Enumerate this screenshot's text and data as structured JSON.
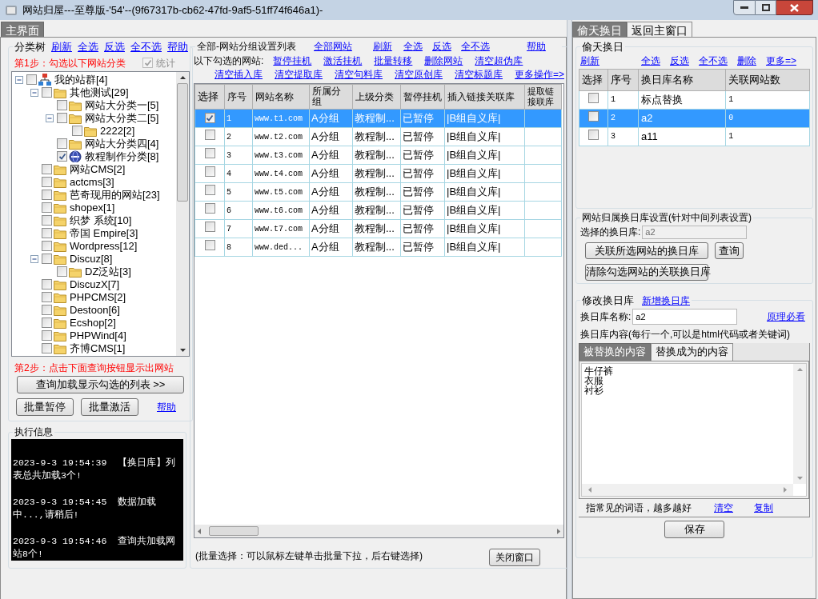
{
  "window": {
    "title": "网站归屋---至尊版-'54'--(9f67317b-cb62-47fd-9af5-51ff74f646a1)-"
  },
  "main_tabs": [
    {
      "label": "主界面",
      "selected": true
    }
  ],
  "category_tree": {
    "title": "分类树",
    "links": [
      "刷新",
      "全选",
      "反选",
      "全不选",
      "帮助"
    ],
    "step1": "第1步：勾选以下网站分类",
    "stats_checkbox": {
      "label": "统计",
      "checked": true,
      "disabled": true
    },
    "items": [
      {
        "label": "我的站群[4]",
        "kind": "network",
        "checked": false,
        "expanded": true,
        "children": [
          {
            "label": "其他测试[29]",
            "kind": "folder",
            "checked": false,
            "expanded": true,
            "children": [
              {
                "label": "网站大分类一[5]",
                "kind": "folder",
                "checked": false
              },
              {
                "label": "网站大分类二[5]",
                "kind": "folder",
                "checked": false,
                "expanded": true,
                "children": [
                  {
                    "label": "2222[2]",
                    "kind": "folder",
                    "checked": false
                  }
                ]
              },
              {
                "label": "网站大分类四[4]",
                "kind": "folder",
                "checked": false
              },
              {
                "label": "教程制作分类[8]",
                "kind": "globe",
                "checked": true
              }
            ]
          },
          {
            "label": "网站CMS[2]",
            "kind": "folder",
            "checked": false
          },
          {
            "label": "actcms[3]",
            "kind": "folder",
            "checked": false
          },
          {
            "label": "芭奇现用的网站[23]",
            "kind": "folder",
            "checked": false
          },
          {
            "label": "shopex[1]",
            "kind": "folder",
            "checked": false
          },
          {
            "label": "织梦 系统[10]",
            "kind": "folder",
            "checked": false
          },
          {
            "label": "帝国 Empire[3]",
            "kind": "folder",
            "checked": false
          },
          {
            "label": "Wordpress[12]",
            "kind": "folder",
            "checked": false
          },
          {
            "label": "Discuz[8]",
            "kind": "folder",
            "checked": false,
            "expanded": true,
            "children": [
              {
                "label": "DZ泛站[3]",
                "kind": "folder",
                "checked": false
              }
            ]
          },
          {
            "label": "DiscuzX[7]",
            "kind": "folder",
            "checked": false
          },
          {
            "label": "PHPCMS[2]",
            "kind": "folder",
            "checked": false
          },
          {
            "label": "Destoon[6]",
            "kind": "folder",
            "checked": false
          },
          {
            "label": "Ecshop[2]",
            "kind": "folder",
            "checked": false
          },
          {
            "label": "PHPWind[4]",
            "kind": "folder",
            "checked": false
          },
          {
            "label": "齐博CMS[1]",
            "kind": "folder",
            "checked": false
          }
        ]
      }
    ],
    "step2": "第2步：点击下面查询按钮显示出网站",
    "load_button": "查询加载显示勾选的列表 >>",
    "buttons": [
      "批量暂停",
      "批量激活"
    ],
    "help_link": "帮助"
  },
  "log": {
    "title": "执行信息",
    "entries": [
      "2023-9-3 19:54:39  【换日库】列表总共加载3个!",
      "2023-9-3 19:54:45  数据加载中...,请稍后!",
      "2023-9-3 19:54:46  查询共加载网站8个!"
    ]
  },
  "site_list": {
    "title": "全部-网站分组设置列表",
    "header_links": [
      "全部网站",
      "刷新",
      "全选",
      "反选",
      "全不选",
      "帮助"
    ],
    "selection_label": "以下勾选的网站:",
    "action_links": [
      [
        "暂停挂机",
        "激活挂机",
        "批量转移",
        "删除网站",
        "清空超伪库"
      ],
      [
        "清空插入库",
        "清空提取库",
        "清空句料库",
        "清空原创库",
        "清空标题库",
        "更多操作=>"
      ]
    ],
    "select_column": "选择",
    "columns": [
      "序号",
      "网站名称",
      "所属分组",
      "上级分类",
      "暂停挂机",
      "插入链接关联库",
      "提取链接联库"
    ],
    "rows": [
      {
        "selected": true,
        "checked": true,
        "cells": [
          "1",
          "www.t1.com",
          "A分组",
          "教程制...",
          "已暂停",
          "|B组自义库|"
        ]
      },
      {
        "selected": false,
        "checked": false,
        "cells": [
          "2",
          "www.t2.com",
          "A分组",
          "教程制...",
          "已暂停",
          "|B组自义库|"
        ]
      },
      {
        "selected": false,
        "checked": false,
        "cells": [
          "3",
          "www.t3.com",
          "A分组",
          "教程制...",
          "已暂停",
          "|B组自义库|"
        ]
      },
      {
        "selected": false,
        "checked": false,
        "cells": [
          "4",
          "www.t4.com",
          "A分组",
          "教程制...",
          "已暂停",
          "|B组自义库|"
        ]
      },
      {
        "selected": false,
        "checked": false,
        "cells": [
          "5",
          "www.t5.com",
          "A分组",
          "教程制...",
          "已暂停",
          "|B组自义库|"
        ]
      },
      {
        "selected": false,
        "checked": false,
        "cells": [
          "6",
          "www.t6.com",
          "A分组",
          "教程制...",
          "已暂停",
          "|B组自义库|"
        ]
      },
      {
        "selected": false,
        "checked": false,
        "cells": [
          "7",
          "www.t7.com",
          "A分组",
          "教程制...",
          "已暂停",
          "|B组自义库|"
        ]
      },
      {
        "selected": false,
        "checked": false,
        "cells": [
          "8",
          "www.ded...",
          "A分组",
          "教程制...",
          "已暂停",
          "|B组自义库|"
        ]
      }
    ],
    "hint": "(批量选择：可以鼠标左键单击批量下拉，后右键选择)",
    "close_button": "关闭窗口"
  },
  "side_tabs": [
    {
      "label": "偷天换日",
      "selected": true
    },
    {
      "label": "返回主窗口",
      "selected": false
    }
  ],
  "swap_group": {
    "title": "偷天换日",
    "refresh_link": "刷新",
    "links": [
      "全选",
      "反选",
      "全不选",
      "删除",
      "更多=>"
    ],
    "select_column": "选择",
    "columns": [
      "序号",
      "换日库名称",
      "关联网站数"
    ],
    "rows": [
      {
        "selected": false,
        "checked": false,
        "cells": [
          "1",
          "标点替换",
          "1"
        ]
      },
      {
        "selected": true,
        "checked": false,
        "cells": [
          "2",
          "a2",
          "0"
        ]
      },
      {
        "selected": false,
        "checked": false,
        "cells": [
          "3",
          "a11",
          "1"
        ]
      }
    ]
  },
  "settings_group": {
    "title": "网站归属换日库设置(针对中间列表设置)",
    "field_label": "选择的换日库:",
    "field_value": "a2",
    "buttons": [
      "关联所选网站的换日库",
      "查询",
      "清除勾选网站的关联换日库"
    ]
  },
  "edit_group": {
    "title": "修改换日库",
    "new_link": "新增换日库",
    "name_label": "换日库名称:",
    "name_value": "a2",
    "principle_link": "原理必看",
    "content_label": "换日库内容(每行一个,可以是html代码或者关键词)",
    "content_tabs": [
      {
        "label": "被替换的内容",
        "selected": true
      },
      {
        "label": "替换成为的内容",
        "selected": false
      }
    ],
    "content_lines": [
      "牛仔裤",
      "衣服",
      "衬衫"
    ],
    "hint": "指常见的词语，越多越好",
    "links": [
      "清空",
      "复制"
    ],
    "save_button": "保存"
  }
}
